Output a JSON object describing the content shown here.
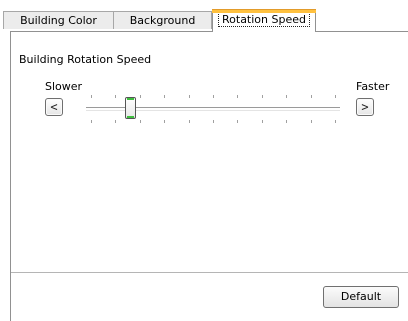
{
  "tabs": [
    {
      "label": "Building Color",
      "active": false
    },
    {
      "label": "Background",
      "active": false
    },
    {
      "label": "Rotation Speed",
      "active": true
    }
  ],
  "rotation": {
    "section_title": "Building Rotation Speed",
    "slower_label": "Slower",
    "faster_label": "Faster",
    "decrease_button": "<",
    "increase_button": ">",
    "tick_count": 11,
    "slider_value_fraction": 0.16
  },
  "footer": {
    "default_button": "Default"
  },
  "colors": {
    "active_tab_accent": "#ffc13f",
    "slider_thumb_accent": "#3fbf3f"
  }
}
